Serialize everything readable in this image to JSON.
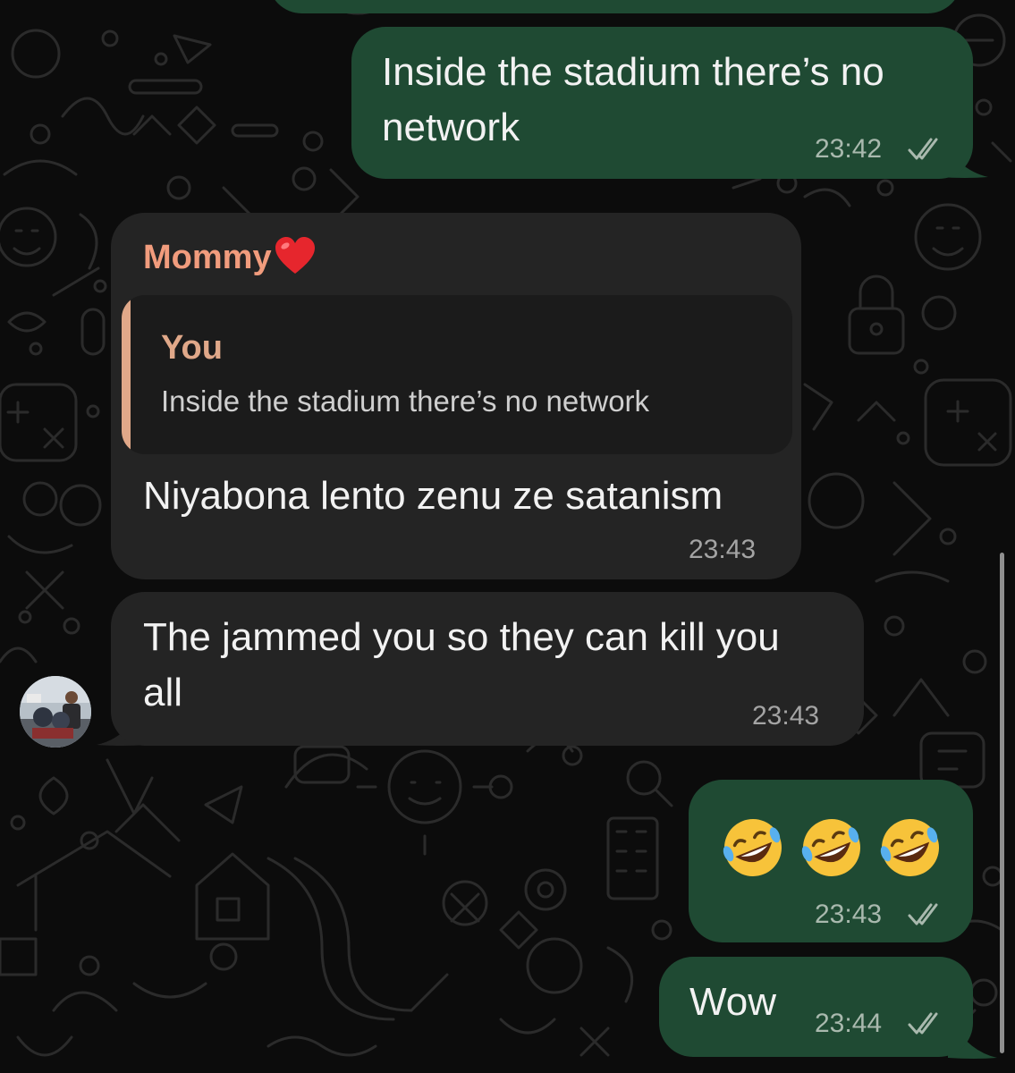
{
  "colors": {
    "background": "#0c0c0c",
    "outgoing_bubble": "#1f4a33",
    "incoming_bubble": "#242424",
    "sender_name": "#f19c7d",
    "quote_accent": "#e0a889",
    "read_ticks": "#a9b9ae"
  },
  "messages": [
    {
      "id": "m1",
      "direction": "outgoing",
      "text": "Inside the stadium there’s no\nnetwork",
      "time": "23:42",
      "status": "read"
    },
    {
      "id": "m2",
      "direction": "incoming",
      "sender": "Mommy",
      "sender_emoji": "❤️",
      "reply_to": {
        "author": "You",
        "text": "Inside the stadium there’s no network"
      },
      "text": "Niyabona lento zenu ze satanism",
      "time": "23:43"
    },
    {
      "id": "m3",
      "direction": "incoming",
      "text": "The jammed you so they can kill you\nall",
      "time": "23:43",
      "avatar": "sender-avatar"
    },
    {
      "id": "m4",
      "direction": "outgoing",
      "emoji": [
        "rolling-on-floor-laughing",
        "rolling-on-floor-laughing",
        "rolling-on-floor-laughing"
      ],
      "time": "23:43",
      "status": "read"
    },
    {
      "id": "m5",
      "direction": "outgoing",
      "text": "Wow",
      "time": "23:44",
      "status": "read"
    }
  ]
}
